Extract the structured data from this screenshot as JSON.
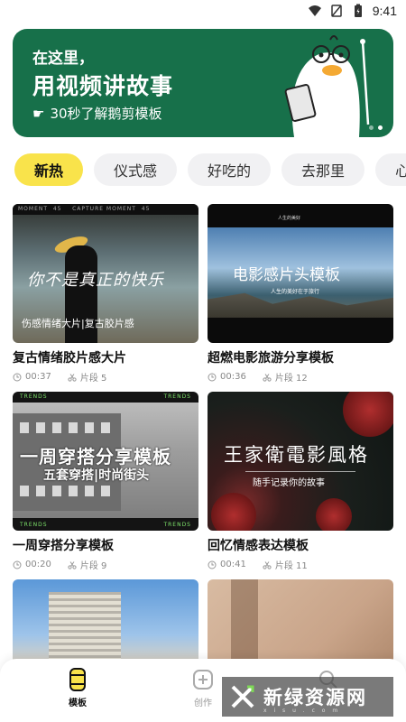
{
  "status_bar": {
    "time": "9:41",
    "icons": [
      "wifi-icon",
      "sim-icon",
      "battery-icon"
    ]
  },
  "banner": {
    "line1": "在这里，",
    "line2": "用视频讲故事",
    "line3": "30秒了解鹅剪模板",
    "icon": "hand-pointing-icon",
    "color": "#17704a"
  },
  "chips": [
    {
      "label": "新热",
      "active": true
    },
    {
      "label": "仪式感",
      "active": false
    },
    {
      "label": "好吃的",
      "active": false
    },
    {
      "label": "去那里",
      "active": false
    },
    {
      "label": "心",
      "active": false
    }
  ],
  "templates": [
    {
      "title": "复古情绪胶片感大片",
      "duration": "00:37",
      "segments": "片段 5",
      "thumb_text": [
        "你不是真正的快乐",
        "伤感情绪大片|复古胶片感"
      ]
    },
    {
      "title": "超燃电影旅游分享模板",
      "duration": "00:36",
      "segments": "片段 12",
      "thumb_text": [
        "电影感片头模板",
        "人生的美好在于旅行",
        "人生的美好"
      ]
    },
    {
      "title": "一周穿搭分享模板",
      "duration": "00:20",
      "segments": "片段 9",
      "thumb_text": [
        "一周穿搭分享模板",
        "五套穿搭|时尚街头",
        "TRENDS"
      ]
    },
    {
      "title": "回忆情感表达模板",
      "duration": "00:41",
      "segments": "片段 11",
      "thumb_text": [
        "王家衛電影風格",
        "随手记录你的故事"
      ]
    },
    {
      "title": "",
      "duration": "",
      "segments": "",
      "thumb_text": []
    },
    {
      "title": "",
      "duration": "",
      "segments": "",
      "thumb_text": []
    }
  ],
  "bottom_nav": [
    {
      "label": "模板",
      "icon": "template-icon",
      "active": true
    },
    {
      "label": "创作",
      "icon": "plus-square-icon",
      "active": false
    },
    {
      "label": "",
      "icon": "search-icon",
      "active": false
    }
  ],
  "watermark": {
    "text": "新绿资源网",
    "sub": "x i s u . c o m",
    "logo": "x-logo-icon"
  },
  "colors": {
    "accent_chip": "#f9e34b",
    "chip_bg": "#f1f1f3"
  }
}
